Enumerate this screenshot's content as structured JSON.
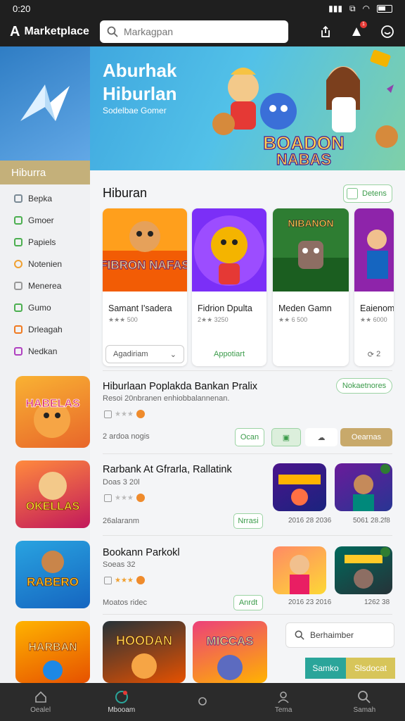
{
  "status": {
    "time": "0:20"
  },
  "topbar": {
    "logo": "Marketplace",
    "search_placeholder": "Markagpan"
  },
  "hero": {
    "title": "Aburhak Hiburlan",
    "subtitle": "Sodelbae Gomer",
    "art_text_1": "BOADON",
    "art_text_2": "NABAS"
  },
  "sidebar": {
    "active": "Hiburra",
    "items": [
      {
        "label": "Bepka",
        "color": "#7a8a95"
      },
      {
        "label": "Gmoer",
        "color": "#4caf50"
      },
      {
        "label": "Papiels",
        "color": "#4caf50"
      },
      {
        "label": "Notenien",
        "color": "#f0a030"
      },
      {
        "label": "Menerea",
        "color": "#999999"
      },
      {
        "label": "Gumo",
        "color": "#4caf50"
      },
      {
        "label": "Drleagah",
        "color": "#f07a20"
      },
      {
        "label": "Nedkan",
        "color": "#b040c0"
      }
    ]
  },
  "section": {
    "title": "Hiburan",
    "details": "Detens"
  },
  "cards": [
    {
      "name": "Samant I'sadera",
      "rating": "★★★ 500",
      "button": "Agadiriam",
      "art": "FIBRON NAFAS"
    },
    {
      "name": "Fidrion Dpulta",
      "rating": "2★★ 3250",
      "button": "Appotiart",
      "art": ""
    },
    {
      "name": "Meden Gamn",
      "rating": "★★ 6 500",
      "button": "",
      "art": "NIBANON"
    },
    {
      "name": "Eaienom",
      "rating": "★★ 6000",
      "button": "2",
      "art": ""
    }
  ],
  "rows": [
    {
      "title": "Hiburlaan Poplakda Bankan Pralix",
      "subtitle": "Resoi 20nbranen enhiobbalannenan.",
      "meta": "2 ardoa nogis",
      "pill": "Nokaetnores",
      "buttons": [
        "Ocan",
        "",
        "",
        "Oearnas"
      ],
      "thumb_text": "HABELAS"
    },
    {
      "title": "Rarbank At Gfrarla, Rallatink",
      "subtitle": "Doas 3 20l",
      "meta": "26alaranm",
      "pill": "Nrrasi",
      "dates": [
        "2016 28 2036",
        "5061 28.2f8"
      ],
      "thumb_text": "OKELLAS"
    },
    {
      "title": "Bookann Parkokl",
      "subtitle": "Soeas 32",
      "meta": "Moatos ridec",
      "pill": "Anrdt",
      "dates": [
        "2016 23 2016",
        "1262 38"
      ],
      "thumb_text": "RABERO"
    }
  ],
  "bottom_tiles": [
    {
      "text": "HARBAN"
    },
    {
      "text": "HOODAN"
    },
    {
      "text": "MICCAS"
    }
  ],
  "float": {
    "search": "Berhaimber",
    "btn1": "Samko",
    "btn2": "Slsdocat"
  },
  "nav": [
    {
      "label": "Oealel"
    },
    {
      "label": "Mbooam"
    },
    {
      "label": ""
    },
    {
      "label": "Tema"
    },
    {
      "label": "Samah"
    }
  ]
}
